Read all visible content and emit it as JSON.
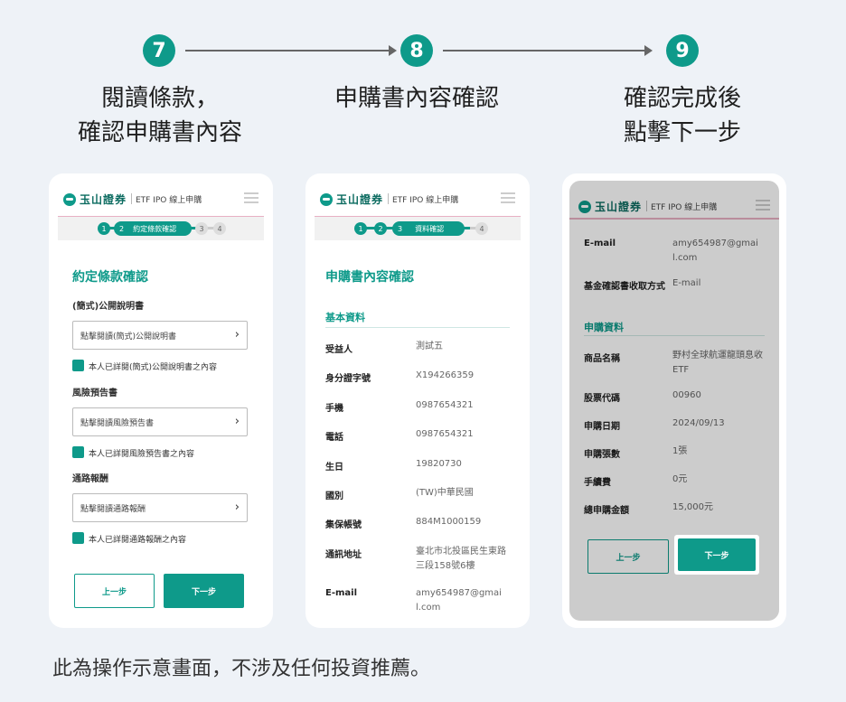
{
  "steps": [
    {
      "num": "7",
      "title_line1": "閱讀條款，",
      "title_line2": "確認申購書內容"
    },
    {
      "num": "8",
      "title_line1": "申購書內容確認",
      "title_line2": ""
    },
    {
      "num": "9",
      "title_line1": "確認完成後",
      "title_line2": "點擊下一步"
    }
  ],
  "app": {
    "logo": "玉山證券",
    "subtitle": "ETF IPO 線上申購",
    "prev_label": "上一步",
    "next_label": "下一步"
  },
  "screen1": {
    "progress": {
      "s1": "1",
      "s2": "2",
      "s2_label": "約定條款確認",
      "s3": "3",
      "s4": "4"
    },
    "title": "約定條款確認",
    "sections": [
      {
        "label": "(簡式)公開說明書",
        "link": "點擊閱讀(簡式)公開說明書",
        "check": "本人已詳閱(簡式)公開說明書之內容"
      },
      {
        "label": "風險預告書",
        "link": "點擊閱讀風險預告書",
        "check": "本人已詳閱風險預告書之內容"
      },
      {
        "label": "通路報酬",
        "link": "點擊閱讀通路報酬",
        "check": "本人已詳閱通路報酬之內容"
      }
    ]
  },
  "screen2": {
    "progress": {
      "s1": "1",
      "s2": "2",
      "s3": "3",
      "s3_label": "資料確認",
      "s4": "4"
    },
    "title": "申購書內容確認",
    "section": "基本資料",
    "rows": [
      {
        "label": "受益人",
        "value": "測試五"
      },
      {
        "label": "身分證字號",
        "value": "X194266359"
      },
      {
        "label": "手機",
        "value": "0987654321"
      },
      {
        "label": "電話",
        "value": "0987654321"
      },
      {
        "label": "生日",
        "value": "19820730"
      },
      {
        "label": "國別",
        "value": "(TW)中華民國"
      },
      {
        "label": "集保帳號",
        "value": "884M1000159"
      },
      {
        "label": "通訊地址",
        "value": "臺北市北投區民生東路三段158號6樓"
      },
      {
        "label": "E-mail",
        "value": "amy654987@gmail.com"
      }
    ]
  },
  "screen3": {
    "top_rows": [
      {
        "label": "E-mail",
        "value": "amy654987@gmail.com"
      },
      {
        "label": "基金確認書收取方式",
        "value": "E-mail"
      }
    ],
    "section": "申購資料",
    "rows": [
      {
        "label": "商品名稱",
        "value": "野村全球航運龍頭息收ETF"
      },
      {
        "label": "股票代碼",
        "value": "00960"
      },
      {
        "label": "申購日期",
        "value": "2024/09/13"
      },
      {
        "label": "申購張數",
        "value": "1張"
      },
      {
        "label": "手續費",
        "value": "0元"
      },
      {
        "label": "總申購金額",
        "value": "15,000元"
      }
    ]
  },
  "disclaimer": "此為操作示意畫面，不涉及任何投資推薦。",
  "colors": {
    "accent": "#0e9a8a",
    "background": "#eef2f7"
  }
}
